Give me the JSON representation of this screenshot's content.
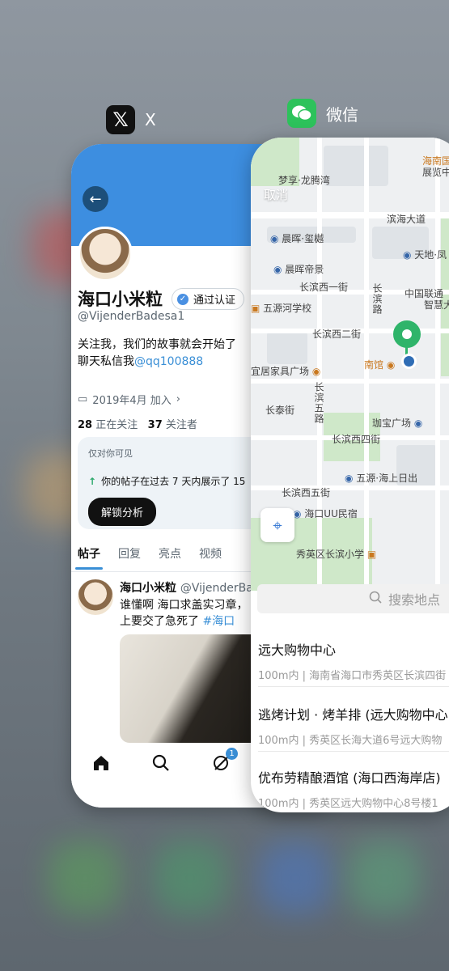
{
  "switcher": {
    "apps": [
      {
        "name": "X",
        "icon": "x-logo-icon",
        "icon_bg": "#111111"
      },
      {
        "name": "微信",
        "icon": "wechat-logo-icon",
        "icon_bg": "#2dc25b"
      }
    ]
  },
  "x_app": {
    "profile_name": "海口小米粒",
    "verified_label": "通过认证",
    "handle": "@VijenderBadesa1",
    "bio_line1": "关注我，我们的故事就会开始了",
    "bio_line2": "聊天私信我",
    "bio_mention": "@qq100888",
    "joined": "2019年4月 加入",
    "following_count": "28",
    "following_label": "正在关注",
    "followers_count": "37",
    "followers_label": "关注者",
    "promo": {
      "private_label": "仅对你可见",
      "stat_text": "你的帖子在过去 7 天内展示了 15",
      "unlock_button": "解锁分析"
    },
    "tabs": [
      "帖子",
      "回复",
      "亮点",
      "视频"
    ],
    "post": {
      "author": "海口小米粒",
      "author_handle": "@VijenderBad",
      "text_line1": "谁懂啊  海口求盖实习章，",
      "text_line2": "上要交了急死了",
      "hashtag": "#海口"
    },
    "notification_badge": "1",
    "accent_color": "#3a8fd6"
  },
  "wechat_app": {
    "cancel_label": "取消",
    "map_labels": {
      "l1": "梦享·龙腾湾",
      "l2": "海南国",
      "l3": "展览中",
      "l4": "滨海大道",
      "l5": "晨晖·玺樾",
      "l6": "天地·凤",
      "l7": "晨晖帝景",
      "l8": "长滨西一街",
      "l9": "中国联通",
      "l10": "智慧大",
      "l11": "五源河学校",
      "l12": "长滨路",
      "l13": "长滨西二街",
      "l14": "南馆",
      "l15": "宜居家具广场",
      "l16": "长泰街",
      "l17": "长滨五路",
      "l18": "珈宝广场",
      "l19": "长滨西四街",
      "l20": "五源·海上日出",
      "l21": "长滨西五街",
      "l22": "海口UU民宿",
      "l23": "秀英区长滨小学"
    },
    "search_placeholder": "搜索地点",
    "places": [
      {
        "title": "远大购物中心",
        "sub": "100m内 | 海南省海口市秀英区长滨四街"
      },
      {
        "title": "逃烤计划 · 烤羊排 (远大购物中心",
        "sub": "100m内 | 秀英区长海大道6号远大购物"
      },
      {
        "title": "优布劳精酿酒馆 (海口西海岸店)",
        "sub": "100m内 | 秀英区远大购物中心8号楼1"
      }
    ],
    "pin_color": "#2fb46a"
  }
}
